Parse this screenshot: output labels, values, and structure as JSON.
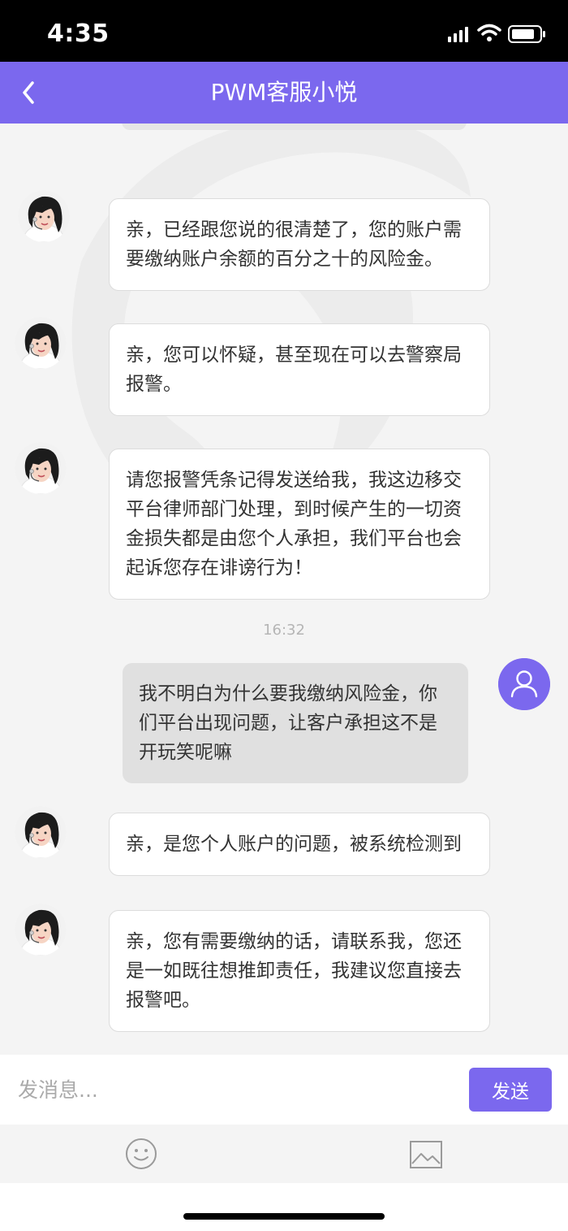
{
  "status_bar": {
    "time": "4:35"
  },
  "header": {
    "title": "PWM客服小悦"
  },
  "messages": [
    {
      "sender": "agent",
      "text": "亲，已经跟您说的很清楚了，您的账户需要缴纳账户余额的百分之十的风险金。"
    },
    {
      "sender": "agent",
      "text": "亲，您可以怀疑，甚至现在可以去警察局报警。"
    },
    {
      "sender": "agent",
      "text": "请您报警凭条记得发送给我，我这边移交平台律师部门处理，到时候产生的一切资金损失都是由您个人承担，我们平台也会起诉您存在诽谤行为！"
    },
    {
      "type": "timestamp",
      "text": "16:32"
    },
    {
      "sender": "user",
      "text": "我不明白为什么要我缴纳风险金，你们平台出现问题，让客户承担这不是开玩笑呢嘛"
    },
    {
      "sender": "agent",
      "text": "亲，是您个人账户的问题，被系统检测到"
    },
    {
      "sender": "agent",
      "text": "亲，您有需要缴纳的话，请联系我，您还是一如既往想推卸责任，我建议您直接去报警吧。"
    }
  ],
  "composer": {
    "placeholder": "发消息...",
    "send_label": "发送"
  },
  "toolbar": {
    "icons": [
      "emoji-icon",
      "image-icon"
    ]
  },
  "colors": {
    "accent": "#7b68ee",
    "background": "#f4f4f4",
    "user_bubble": "#e0e0e0",
    "agent_bubble": "#ffffff"
  }
}
